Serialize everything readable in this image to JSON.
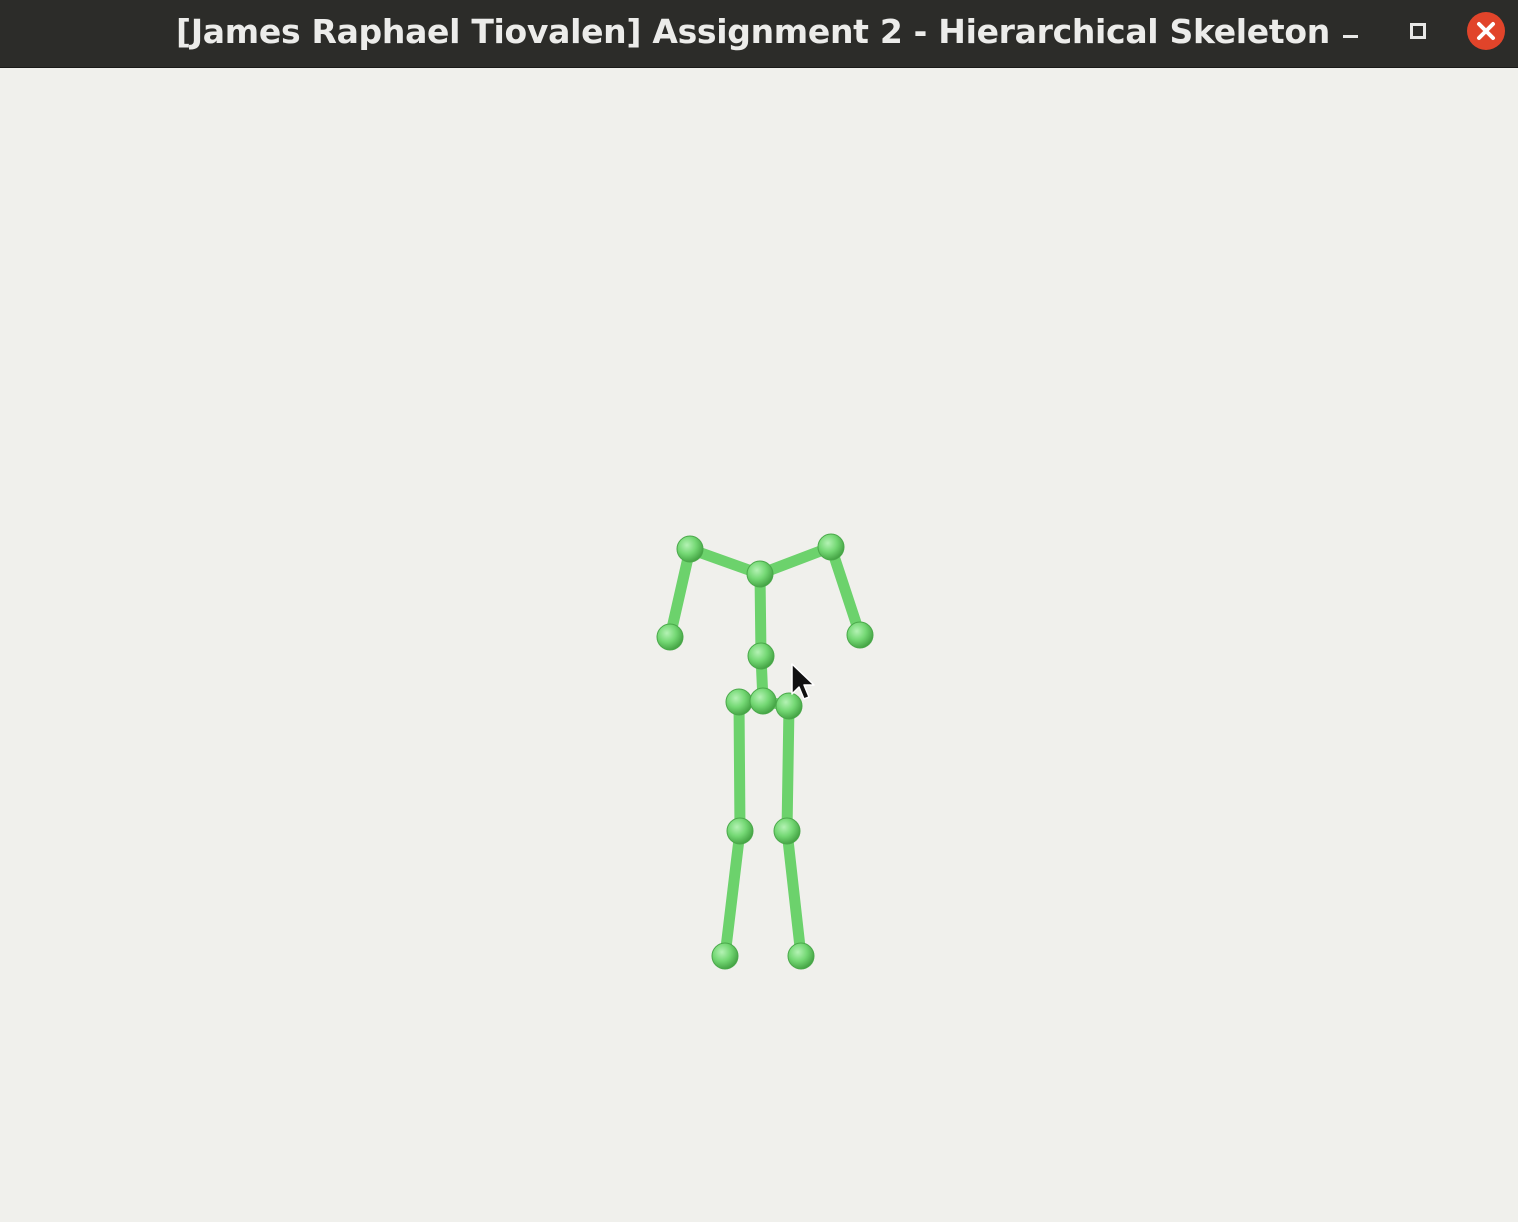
{
  "window": {
    "title": "[James Raphael Tiovalen] Assignment 2 - Hierarchical Skeleton",
    "controls": {
      "minimize_icon": "minimize-icon",
      "maximize_icon": "maximize-icon",
      "close_icon": "close-icon"
    }
  },
  "colors": {
    "titlebar": "#2c2c29",
    "background": "#f0f0ec",
    "bone": "#72d872",
    "close_button": "#e1442a"
  },
  "viewport": {
    "scene": "hierarchical-skeleton",
    "cursor_icon": "mouse-pointer-icon"
  }
}
